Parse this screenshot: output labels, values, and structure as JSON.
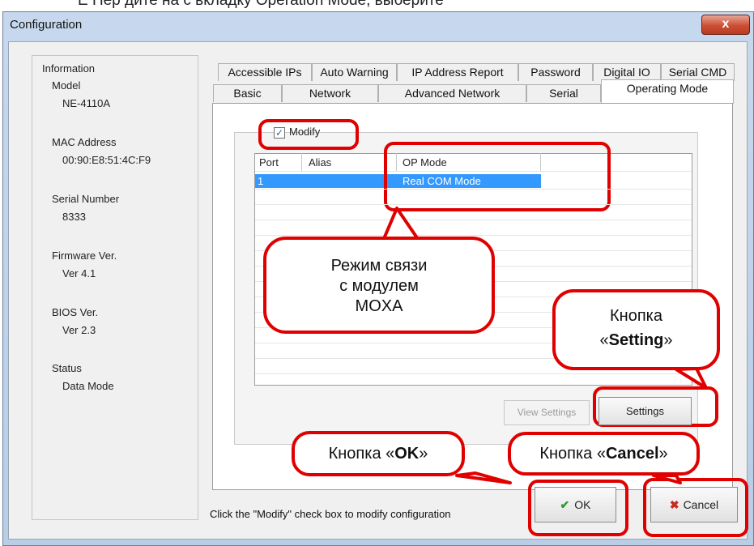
{
  "window": {
    "title": "Configuration",
    "close_glyph": "x"
  },
  "top_caption_fragment": "Е Пер дите на с  вкладку Operation Mode, выберите",
  "info": {
    "title": "Information",
    "items": [
      {
        "label": "Model",
        "value": "NE-4110A"
      },
      {
        "label": "MAC Address",
        "value": "00:90:E8:51:4C:F9"
      },
      {
        "label": "Serial Number",
        "value": "8333"
      },
      {
        "label": "Firmware Ver.",
        "value": "Ver 4.1"
      },
      {
        "label": "BIOS Ver.",
        "value": "Ver 2.3"
      },
      {
        "label": "Status",
        "value": "Data Mode"
      }
    ]
  },
  "tabs": {
    "row1": [
      "Accessible IPs",
      "Auto Warning",
      "IP Address Report",
      "Password",
      "Digital IO",
      "Serial CMD"
    ],
    "row2": [
      "Basic",
      "Network",
      "Advanced Network",
      "Serial",
      "Operating Mode"
    ]
  },
  "modify": {
    "label": "Modify",
    "checked": true
  },
  "table": {
    "columns": [
      "Port",
      "Alias",
      "OP Mode"
    ],
    "rows": [
      {
        "port": "1",
        "alias": "",
        "op_mode": "Real COM Mode"
      }
    ]
  },
  "buttons": {
    "view_settings": "View Settings",
    "settings": "Settings",
    "ok": "OK",
    "cancel": "Cancel"
  },
  "hint": "Click the \"Modify\" check box to modify configuration",
  "callouts": {
    "mode_line1": "Режим связи",
    "mode_line2": "с модулем",
    "mode_line3": "MOXA",
    "setting_line1": "Кнопка",
    "setting_prefix": "«",
    "setting_word": "Setting",
    "setting_suffix": "»",
    "ok_prefix": "Кнопка «",
    "ok_word": "OK",
    "ok_suffix": "»",
    "cancel_prefix": "Кнопка «",
    "cancel_word": "Cancel",
    "cancel_suffix": "»"
  },
  "colors": {
    "highlight": "#3399ff",
    "annotation_red": "#e00000",
    "window_frame": "#c7d8ee"
  },
  "icons": {
    "ok": "check-icon",
    "cancel": "x-icon",
    "checkbox": "checkmark-icon"
  }
}
